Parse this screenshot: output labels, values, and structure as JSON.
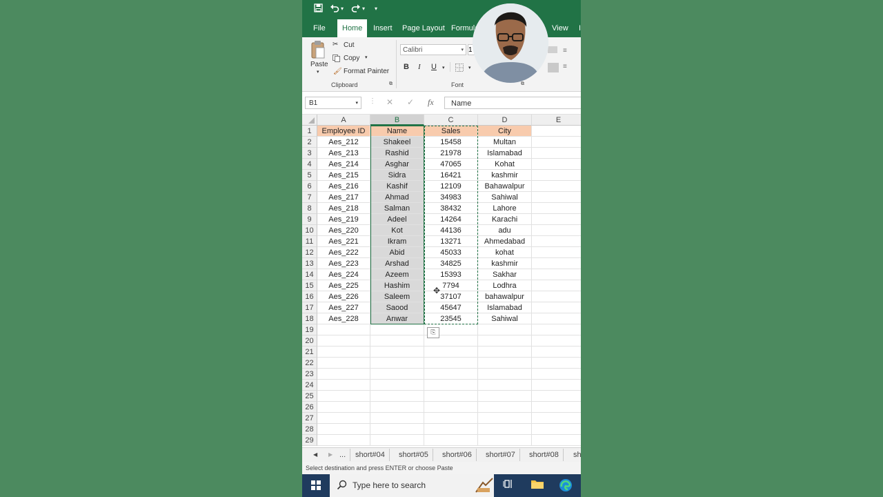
{
  "quick_access": {
    "save_icon": "save-icon",
    "undo_icon": "undo-icon",
    "redo_icon": "redo-icon",
    "customize": "▾"
  },
  "ribbon_tabs": [
    "File",
    "Home",
    "Insert",
    "Page Layout",
    "Formula",
    "View",
    "I"
  ],
  "active_tab": "Home",
  "clipboard": {
    "paste": "Paste",
    "cut": "Cut",
    "copy": "Copy",
    "format_painter": "Format Painter",
    "group_label": "Clipboard"
  },
  "font": {
    "name": "Calibri",
    "size": "1",
    "bold": "B",
    "italic": "I",
    "underline": "U",
    "group_label": "Font"
  },
  "formula_bar": {
    "name_box": "B1",
    "fx": "fx",
    "content": "Name"
  },
  "columns": [
    "A",
    "B",
    "C",
    "D",
    "E"
  ],
  "row_numbers": [
    "1",
    "2",
    "3",
    "4",
    "5",
    "6",
    "7",
    "8",
    "9",
    "10",
    "11",
    "12",
    "13",
    "14",
    "15",
    "16",
    "17",
    "18",
    "19",
    "20",
    "21",
    "22",
    "23",
    "24",
    "25",
    "26",
    "27",
    "28",
    "29"
  ],
  "headers": [
    "Employee ID",
    "Name",
    "Sales",
    "City"
  ],
  "rows": [
    [
      "Aes_212",
      "Shakeel",
      "15458",
      "Multan"
    ],
    [
      "Aes_213",
      "Rashid",
      "21978",
      "Islamabad"
    ],
    [
      "Aes_214",
      "Asghar",
      "47065",
      "Kohat"
    ],
    [
      "Aes_215",
      "Sidra",
      "16421",
      "kashmir"
    ],
    [
      "Aes_216",
      "Kashif",
      "12109",
      "Bahawalpur"
    ],
    [
      "Aes_217",
      "Ahmad",
      "34983",
      "Sahiwal"
    ],
    [
      "Aes_218",
      "Salman",
      "38432",
      "Lahore"
    ],
    [
      "Aes_219",
      "Adeel",
      "14264",
      "Karachi"
    ],
    [
      "Aes_220",
      "Kot",
      "44136",
      "adu"
    ],
    [
      "Aes_221",
      "Ikram",
      "13271",
      "Ahmedabad"
    ],
    [
      "Aes_222",
      "Abid",
      "45033",
      "kohat"
    ],
    [
      "Aes_223",
      "Arshad",
      "34825",
      "kashmir"
    ],
    [
      "Aes_224",
      "Azeem",
      "15393",
      "Sakhar"
    ],
    [
      "Aes_225",
      "Hashim",
      "7794",
      "Lodhra"
    ],
    [
      "Aes_226",
      "Saleem",
      "37107",
      "bahawalpur"
    ],
    [
      "Aes_227",
      "Saood",
      "45647",
      "Islamabad"
    ],
    [
      "Aes_228",
      "Anwar",
      "23545",
      "Sahiwal"
    ]
  ],
  "sheet_tabs": [
    "...",
    "short#04",
    "short#05",
    "short#06",
    "short#07",
    "short#08",
    "sh"
  ],
  "status": "Select destination and press ENTER or choose Paste",
  "taskbar": {
    "search_placeholder": "Type here to search"
  },
  "colors": {
    "excel_green": "#217346",
    "header_fill": "#f8cbad",
    "selection_fill": "#d9d9d9",
    "background": "#4c8a5f"
  }
}
